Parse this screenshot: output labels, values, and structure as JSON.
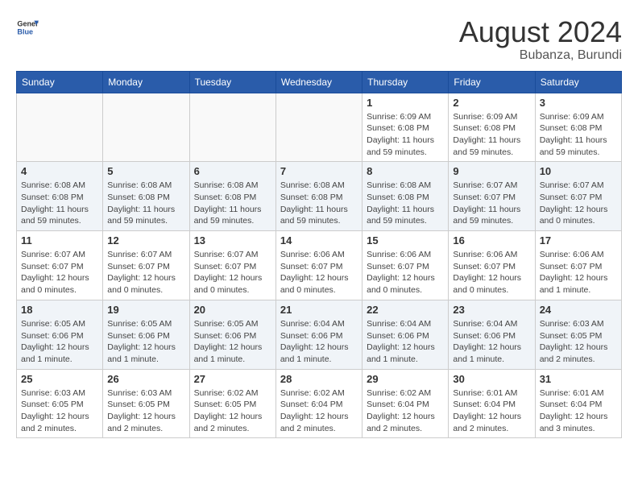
{
  "header": {
    "logo_line1": "General",
    "logo_line2": "Blue",
    "month_year": "August 2024",
    "location": "Bubanza, Burundi"
  },
  "weekdays": [
    "Sunday",
    "Monday",
    "Tuesday",
    "Wednesday",
    "Thursday",
    "Friday",
    "Saturday"
  ],
  "weeks": [
    [
      {
        "day": "",
        "sunrise": "",
        "sunset": "",
        "daylight": ""
      },
      {
        "day": "",
        "sunrise": "",
        "sunset": "",
        "daylight": ""
      },
      {
        "day": "",
        "sunrise": "",
        "sunset": "",
        "daylight": ""
      },
      {
        "day": "",
        "sunrise": "",
        "sunset": "",
        "daylight": ""
      },
      {
        "day": "1",
        "sunrise": "Sunrise: 6:09 AM",
        "sunset": "Sunset: 6:08 PM",
        "daylight": "Daylight: 11 hours and 59 minutes."
      },
      {
        "day": "2",
        "sunrise": "Sunrise: 6:09 AM",
        "sunset": "Sunset: 6:08 PM",
        "daylight": "Daylight: 11 hours and 59 minutes."
      },
      {
        "day": "3",
        "sunrise": "Sunrise: 6:09 AM",
        "sunset": "Sunset: 6:08 PM",
        "daylight": "Daylight: 11 hours and 59 minutes."
      }
    ],
    [
      {
        "day": "4",
        "sunrise": "Sunrise: 6:08 AM",
        "sunset": "Sunset: 6:08 PM",
        "daylight": "Daylight: 11 hours and 59 minutes."
      },
      {
        "day": "5",
        "sunrise": "Sunrise: 6:08 AM",
        "sunset": "Sunset: 6:08 PM",
        "daylight": "Daylight: 11 hours and 59 minutes."
      },
      {
        "day": "6",
        "sunrise": "Sunrise: 6:08 AM",
        "sunset": "Sunset: 6:08 PM",
        "daylight": "Daylight: 11 hours and 59 minutes."
      },
      {
        "day": "7",
        "sunrise": "Sunrise: 6:08 AM",
        "sunset": "Sunset: 6:08 PM",
        "daylight": "Daylight: 11 hours and 59 minutes."
      },
      {
        "day": "8",
        "sunrise": "Sunrise: 6:08 AM",
        "sunset": "Sunset: 6:08 PM",
        "daylight": "Daylight: 11 hours and 59 minutes."
      },
      {
        "day": "9",
        "sunrise": "Sunrise: 6:07 AM",
        "sunset": "Sunset: 6:07 PM",
        "daylight": "Daylight: 11 hours and 59 minutes."
      },
      {
        "day": "10",
        "sunrise": "Sunrise: 6:07 AM",
        "sunset": "Sunset: 6:07 PM",
        "daylight": "Daylight: 12 hours and 0 minutes."
      }
    ],
    [
      {
        "day": "11",
        "sunrise": "Sunrise: 6:07 AM",
        "sunset": "Sunset: 6:07 PM",
        "daylight": "Daylight: 12 hours and 0 minutes."
      },
      {
        "day": "12",
        "sunrise": "Sunrise: 6:07 AM",
        "sunset": "Sunset: 6:07 PM",
        "daylight": "Daylight: 12 hours and 0 minutes."
      },
      {
        "day": "13",
        "sunrise": "Sunrise: 6:07 AM",
        "sunset": "Sunset: 6:07 PM",
        "daylight": "Daylight: 12 hours and 0 minutes."
      },
      {
        "day": "14",
        "sunrise": "Sunrise: 6:06 AM",
        "sunset": "Sunset: 6:07 PM",
        "daylight": "Daylight: 12 hours and 0 minutes."
      },
      {
        "day": "15",
        "sunrise": "Sunrise: 6:06 AM",
        "sunset": "Sunset: 6:07 PM",
        "daylight": "Daylight: 12 hours and 0 minutes."
      },
      {
        "day": "16",
        "sunrise": "Sunrise: 6:06 AM",
        "sunset": "Sunset: 6:07 PM",
        "daylight": "Daylight: 12 hours and 0 minutes."
      },
      {
        "day": "17",
        "sunrise": "Sunrise: 6:06 AM",
        "sunset": "Sunset: 6:07 PM",
        "daylight": "Daylight: 12 hours and 1 minute."
      }
    ],
    [
      {
        "day": "18",
        "sunrise": "Sunrise: 6:05 AM",
        "sunset": "Sunset: 6:06 PM",
        "daylight": "Daylight: 12 hours and 1 minute."
      },
      {
        "day": "19",
        "sunrise": "Sunrise: 6:05 AM",
        "sunset": "Sunset: 6:06 PM",
        "daylight": "Daylight: 12 hours and 1 minute."
      },
      {
        "day": "20",
        "sunrise": "Sunrise: 6:05 AM",
        "sunset": "Sunset: 6:06 PM",
        "daylight": "Daylight: 12 hours and 1 minute."
      },
      {
        "day": "21",
        "sunrise": "Sunrise: 6:04 AM",
        "sunset": "Sunset: 6:06 PM",
        "daylight": "Daylight: 12 hours and 1 minute."
      },
      {
        "day": "22",
        "sunrise": "Sunrise: 6:04 AM",
        "sunset": "Sunset: 6:06 PM",
        "daylight": "Daylight: 12 hours and 1 minute."
      },
      {
        "day": "23",
        "sunrise": "Sunrise: 6:04 AM",
        "sunset": "Sunset: 6:06 PM",
        "daylight": "Daylight: 12 hours and 1 minute."
      },
      {
        "day": "24",
        "sunrise": "Sunrise: 6:03 AM",
        "sunset": "Sunset: 6:05 PM",
        "daylight": "Daylight: 12 hours and 2 minutes."
      }
    ],
    [
      {
        "day": "25",
        "sunrise": "Sunrise: 6:03 AM",
        "sunset": "Sunset: 6:05 PM",
        "daylight": "Daylight: 12 hours and 2 minutes."
      },
      {
        "day": "26",
        "sunrise": "Sunrise: 6:03 AM",
        "sunset": "Sunset: 6:05 PM",
        "daylight": "Daylight: 12 hours and 2 minutes."
      },
      {
        "day": "27",
        "sunrise": "Sunrise: 6:02 AM",
        "sunset": "Sunset: 6:05 PM",
        "daylight": "Daylight: 12 hours and 2 minutes."
      },
      {
        "day": "28",
        "sunrise": "Sunrise: 6:02 AM",
        "sunset": "Sunset: 6:04 PM",
        "daylight": "Daylight: 12 hours and 2 minutes."
      },
      {
        "day": "29",
        "sunrise": "Sunrise: 6:02 AM",
        "sunset": "Sunset: 6:04 PM",
        "daylight": "Daylight: 12 hours and 2 minutes."
      },
      {
        "day": "30",
        "sunrise": "Sunrise: 6:01 AM",
        "sunset": "Sunset: 6:04 PM",
        "daylight": "Daylight: 12 hours and 2 minutes."
      },
      {
        "day": "31",
        "sunrise": "Sunrise: 6:01 AM",
        "sunset": "Sunset: 6:04 PM",
        "daylight": "Daylight: 12 hours and 3 minutes."
      }
    ]
  ]
}
